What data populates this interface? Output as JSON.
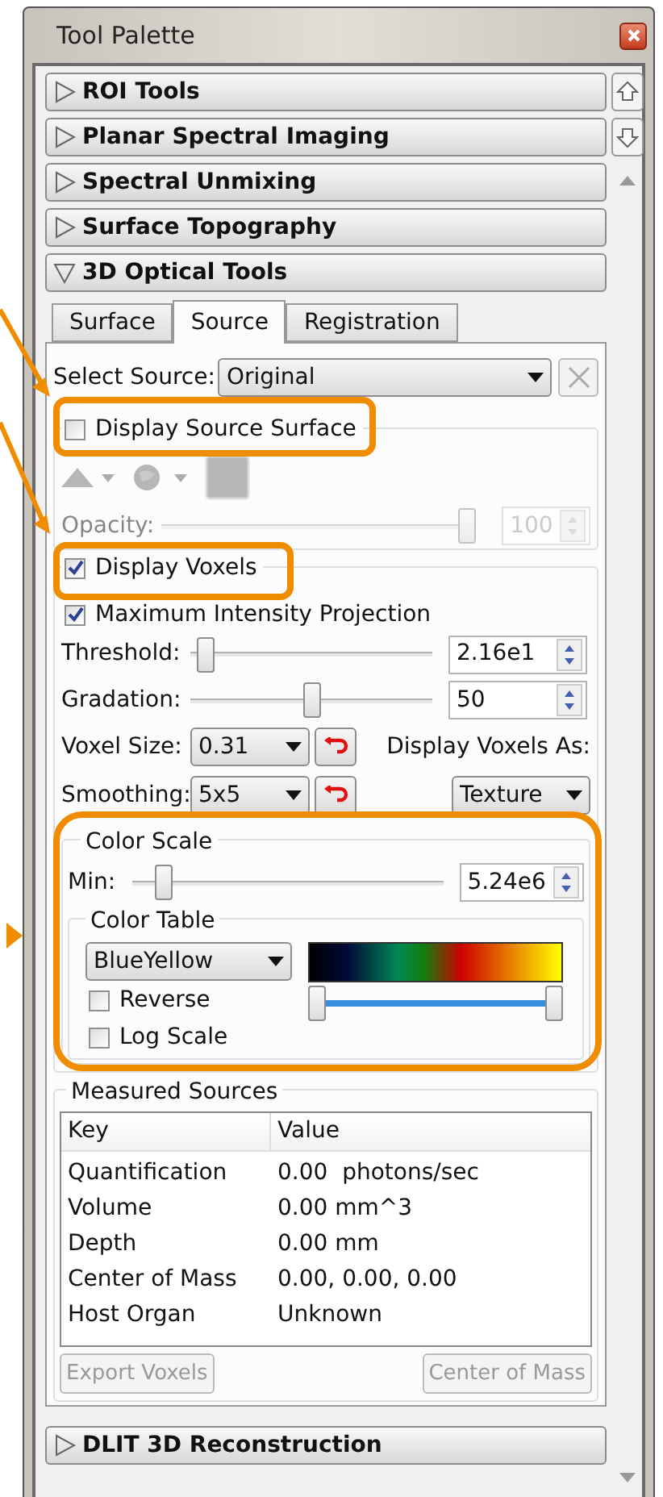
{
  "window": {
    "title": "Tool Palette"
  },
  "sections": [
    {
      "label": "ROI Tools",
      "expanded": false
    },
    {
      "label": "Planar Spectral Imaging",
      "expanded": false
    },
    {
      "label": "Spectral Unmixing",
      "expanded": false
    },
    {
      "label": "Surface Topography",
      "expanded": false
    },
    {
      "label": "3D Optical Tools",
      "expanded": true
    },
    {
      "label": "DLIT 3D Reconstruction",
      "expanded": false
    }
  ],
  "tabs": [
    {
      "label": "Surface",
      "selected": false
    },
    {
      "label": "Source",
      "selected": true
    },
    {
      "label": "Registration",
      "selected": false
    }
  ],
  "select_source": {
    "label": "Select Source:",
    "value": "Original"
  },
  "display_source_surface": {
    "label": "Display Source Surface",
    "checked": false
  },
  "opacity": {
    "label": "Opacity:",
    "level": 1,
    "value": "100",
    "disabled": true
  },
  "display_voxels": {
    "label": "Display Voxels",
    "checked": true
  },
  "mip": {
    "label": "Maximum Intensity Projection",
    "checked": true
  },
  "threshold": {
    "label": "Threshold:",
    "level": 0.03,
    "value": "2.16e1"
  },
  "gradation": {
    "label": "Gradation:",
    "level": 0.5,
    "value": "50"
  },
  "voxel_size": {
    "label": "Voxel Size:",
    "value": "0.31"
  },
  "display_as": {
    "label": "Display Voxels As:",
    "value": "Texture"
  },
  "smoothing": {
    "label": "Smoothing:",
    "value": "5x5"
  },
  "color_scale": {
    "title": "Color Scale",
    "min_label": "Min:",
    "level": 0.08,
    "value": "5.24e6"
  },
  "color_table": {
    "title": "Color Table",
    "value": "BlueYellow",
    "reverse": {
      "label": "Reverse",
      "checked": false
    },
    "log_scale": {
      "label": "Log Scale",
      "checked": false
    },
    "range_low": {
      "level": 0
    },
    "range_high": {
      "level": 1
    }
  },
  "measured_sources": {
    "title": "Measured Sources",
    "columns": [
      "Key",
      "Value"
    ],
    "rows": [
      [
        "Quantification",
        "0.00  photons/sec"
      ],
      [
        "Volume",
        "0.00 mm^3"
      ],
      [
        "Depth",
        "0.00 mm"
      ],
      [
        "Center of Mass",
        "0.00, 0.00, 0.00"
      ],
      [
        "Host Organ",
        "Unknown"
      ]
    ]
  },
  "buttons": [
    {
      "label": "Export Voxels",
      "disabled": true
    },
    {
      "label": "Center of Mass",
      "disabled": true
    }
  ]
}
